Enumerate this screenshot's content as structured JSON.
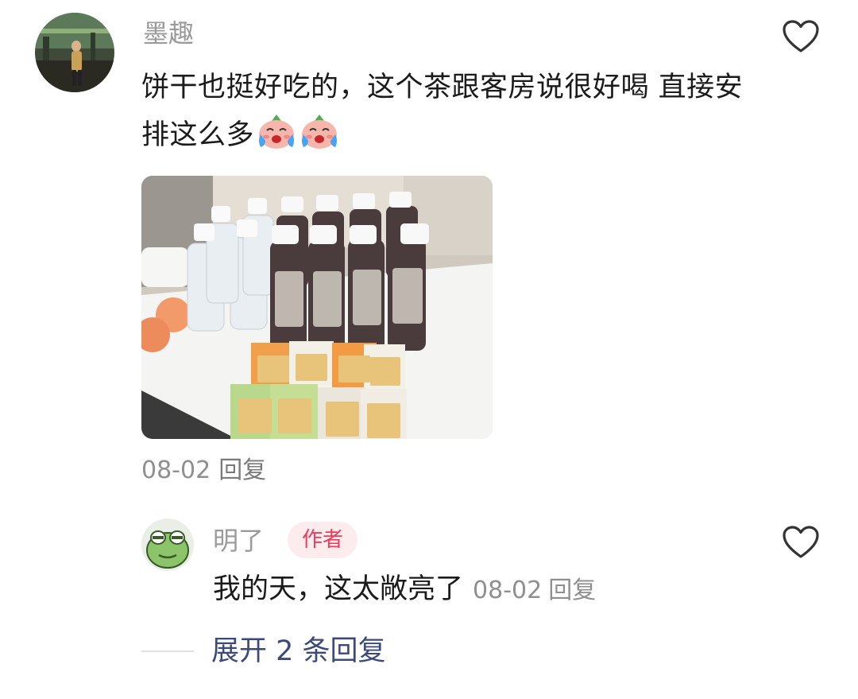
{
  "comment": {
    "username": "墨趣",
    "text": "饼干也挺好吃的，这个茶跟客房说很好喝 直接安排这么多",
    "date": "08-02",
    "reply_label": "回复",
    "emoji_name": "crying-face-emoji"
  },
  "reply": {
    "username": "明了",
    "badge": "作者",
    "text": "我的天，这太敞亮了",
    "date": "08-02",
    "reply_label": "回复"
  },
  "expand": {
    "label": "展开 2 条回复"
  },
  "colors": {
    "username": "#9a9a9a",
    "badge_bg": "#fdecee",
    "badge_text": "#f03a5a",
    "expand_link": "#3c4a7a"
  }
}
